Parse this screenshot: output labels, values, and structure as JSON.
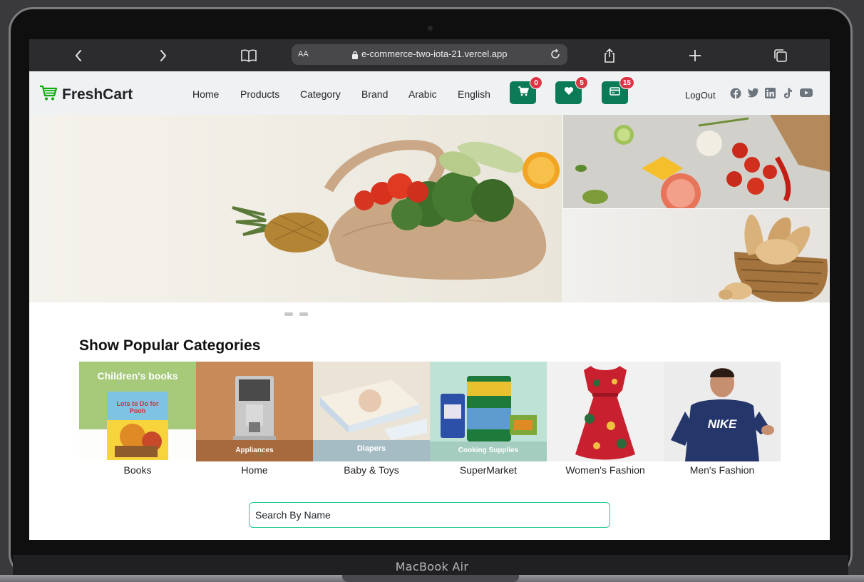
{
  "device": {
    "label": "MacBook Air"
  },
  "browser": {
    "aa_label": "AA",
    "url": "e-commerce-two-iota-21.vercel.app",
    "icons": [
      "chevron-left-icon",
      "chevron-right-icon",
      "book-icon",
      "lock-icon",
      "reload-icon",
      "share-icon",
      "plus-icon",
      "tabs-icon"
    ]
  },
  "site": {
    "brand": "FreshCart",
    "brand_color": "#0aad0a",
    "accent_color": "#0b7a56",
    "nav": {
      "links": [
        "Home",
        "Products",
        "Category",
        "Brand",
        "Arabic",
        "English"
      ],
      "cart_count": "0",
      "wishlist_count": "5",
      "orders_count": "15",
      "logout": "LogOut",
      "social": [
        "facebook-icon",
        "twitter-icon",
        "linkedin-icon",
        "tiktok-icon",
        "youtube-icon"
      ]
    },
    "slider": {
      "dots": 2
    },
    "categories": {
      "title": "Show Popular Categories",
      "items": [
        {
          "name": "Books",
          "image_caption": "Children's books",
          "book_title": "Lots to Do for Pooh"
        },
        {
          "name": "Home",
          "image_caption": "Appliances"
        },
        {
          "name": "Baby & Toys",
          "image_caption": "Diapers"
        },
        {
          "name": "SuperMarket",
          "image_caption": "Cooking Supplies"
        },
        {
          "name": "Women's Fashion"
        },
        {
          "name": "Men's Fashion",
          "shirt_text": "NIKE"
        }
      ]
    },
    "search": {
      "placeholder": "Search By Name",
      "value": ""
    }
  }
}
